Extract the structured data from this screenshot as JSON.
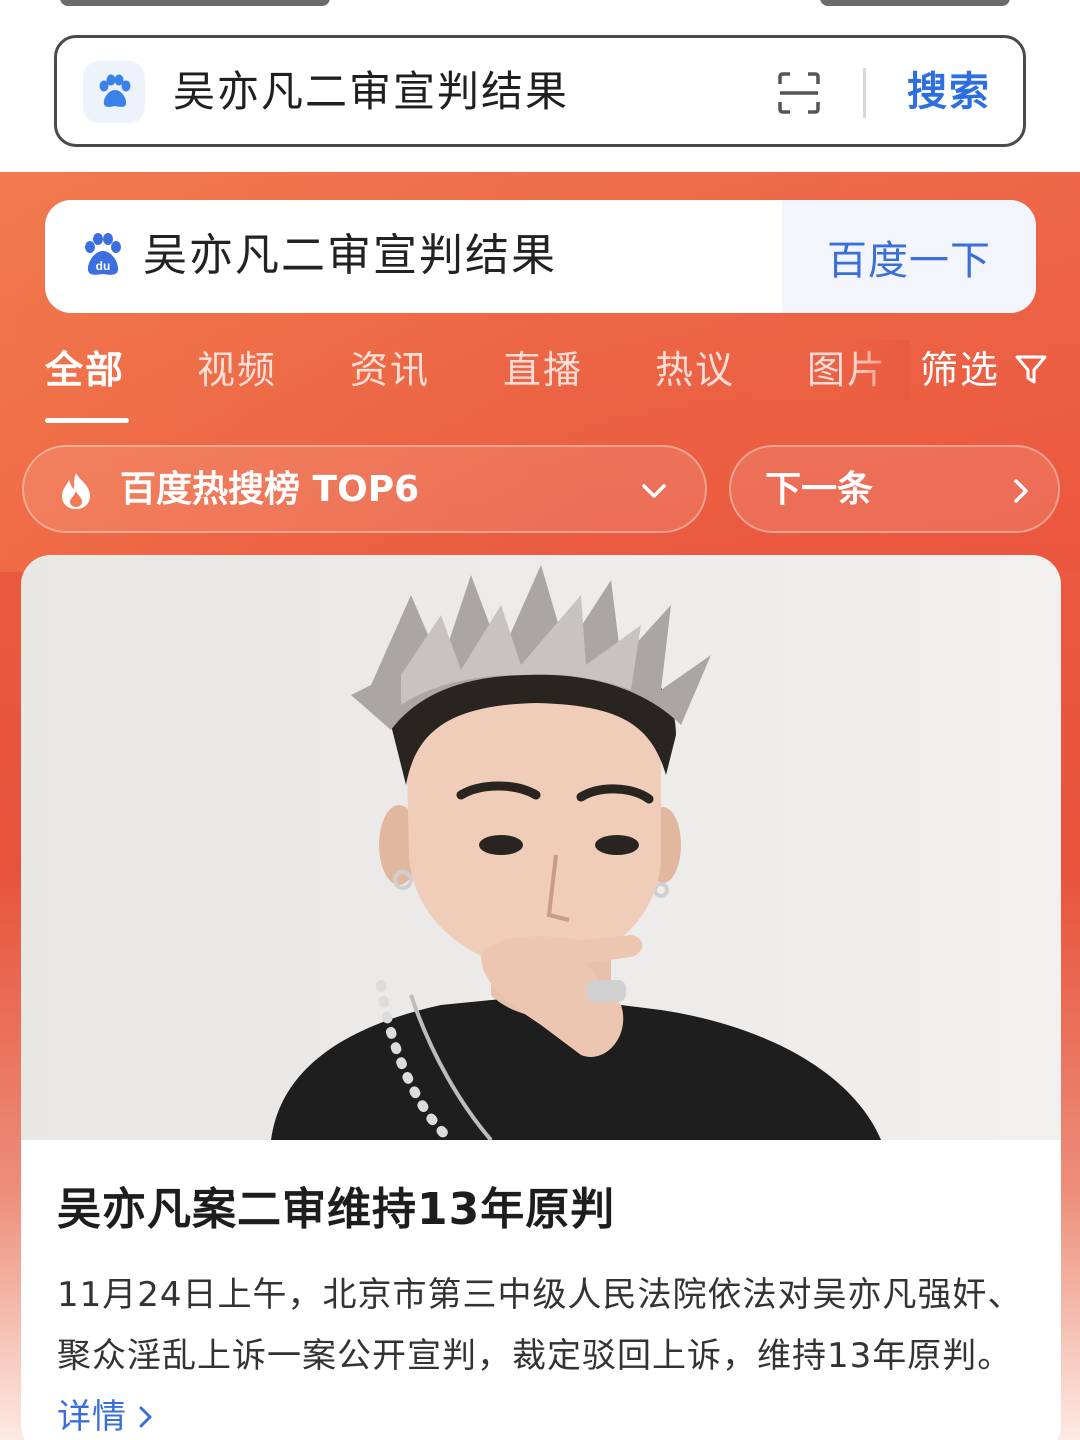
{
  "top_search": {
    "query": "吴亦凡二审宣判结果",
    "search_label": "搜索"
  },
  "baidu_search": {
    "query": "吴亦凡二审宣判结果",
    "button_label": "百度一下"
  },
  "tabs": [
    {
      "label": "全部",
      "active": true
    },
    {
      "label": "视频",
      "active": false
    },
    {
      "label": "资讯",
      "active": false
    },
    {
      "label": "直播",
      "active": false
    },
    {
      "label": "热议",
      "active": false
    },
    {
      "label": "图片",
      "active": false
    }
  ],
  "filter_label": "筛选",
  "hot_list": {
    "label": "百度热搜榜 TOP6",
    "next_label": "下一条"
  },
  "news": {
    "title": "吴亦凡案二审维持13年原判",
    "body": "11月24日上午，北京市第三中级人民法院依法对吴亦凡强奸、聚众淫乱上诉一案公开宣判，裁定驳回上诉，维持13年原判。",
    "more_label": "详情"
  },
  "colors": {
    "accent_blue": "#3a6fd8",
    "hero_orange": "#ea5a3f"
  }
}
